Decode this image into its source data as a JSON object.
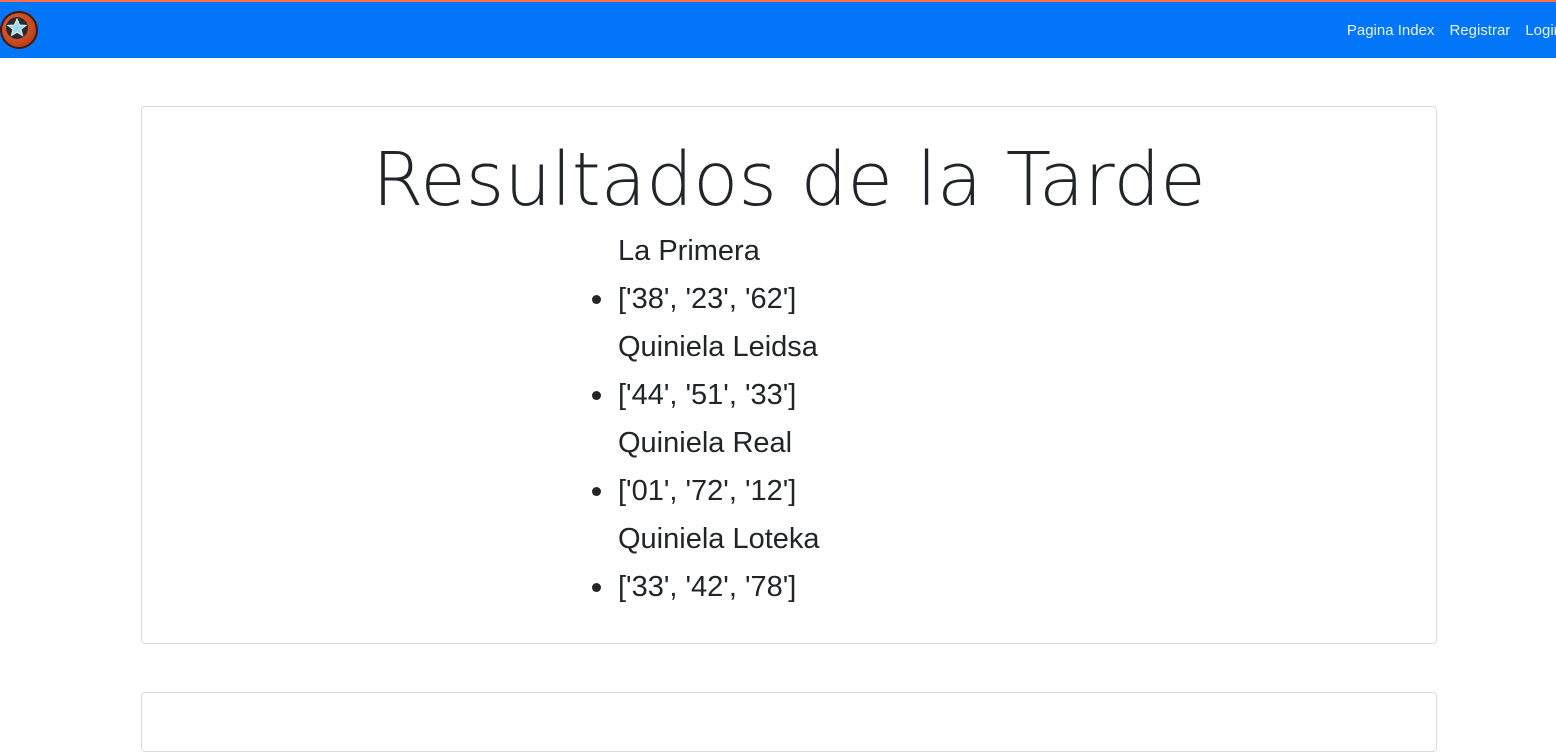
{
  "navbar": {
    "logo": "star-logo-icon",
    "links": [
      "Pagina Index",
      "Registrar",
      "Login"
    ]
  },
  "main": {
    "title": "Resultados de la Tarde",
    "results": [
      {
        "name": "La Primera",
        "numbers": "['38', '23', '62']"
      },
      {
        "name": "Quiniela Leidsa",
        "numbers": "['44', '51', '33']"
      },
      {
        "name": "Quiniela Real",
        "numbers": "['01', '72', '12']"
      },
      {
        "name": "Quiniela Loteka",
        "numbers": "['33', '42', '78']"
      }
    ]
  },
  "colors": {
    "navbar": "#0275f8",
    "accent_top": "#ff7043",
    "text": "#212529"
  }
}
